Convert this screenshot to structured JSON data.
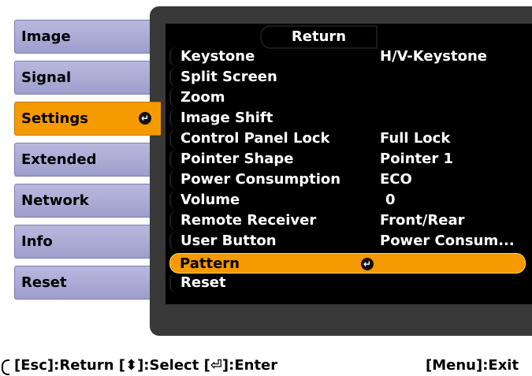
{
  "tabs": [
    {
      "label": "Image",
      "active": false
    },
    {
      "label": "Signal",
      "active": false
    },
    {
      "label": "Settings",
      "active": true
    },
    {
      "label": "Extended",
      "active": false
    },
    {
      "label": "Network",
      "active": false
    },
    {
      "label": "Info",
      "active": false
    },
    {
      "label": "Reset",
      "active": false
    }
  ],
  "return_label": "Return",
  "menu": [
    {
      "label": "Keystone",
      "value": "H/V-Keystone"
    },
    {
      "label": "Split Screen",
      "value": ""
    },
    {
      "label": "Zoom",
      "value": ""
    },
    {
      "label": "Image Shift",
      "value": ""
    },
    {
      "label": "Control Panel Lock",
      "value": "Full Lock"
    },
    {
      "label": "Pointer Shape",
      "value": "Pointer 1"
    },
    {
      "label": "Power Consumption",
      "value": "ECO"
    },
    {
      "label": "Volume",
      "value": " 0"
    },
    {
      "label": "Remote Receiver",
      "value": "Front/Rear"
    },
    {
      "label": "User Button",
      "value": "Power Consum..."
    },
    {
      "label": "Pattern",
      "value": "",
      "selected": true
    },
    {
      "label": "Reset",
      "value": ""
    }
  ],
  "footer": {
    "help": "[Esc]:Return [⬍]:Select [⏎]:Enter",
    "exit": "[Menu]:Exit"
  },
  "colors": {
    "accent": "#f59a00",
    "tab": "#a8a8d4",
    "panel": "#393939"
  }
}
